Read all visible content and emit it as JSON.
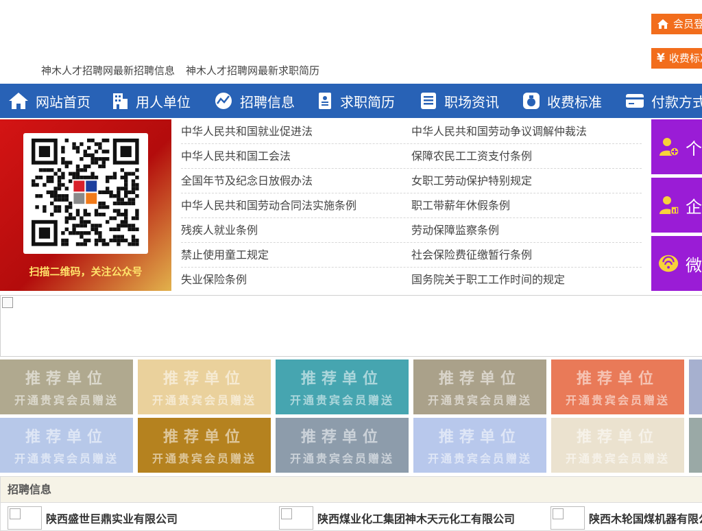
{
  "header": {
    "member_login": "会员登录",
    "pricing": "收费标准",
    "links": [
      "神木人才招聘网最新招聘信息",
      "神木人才招聘网最新求职简历"
    ]
  },
  "nav": [
    {
      "label": "网站首页",
      "icon": "home-icon"
    },
    {
      "label": "用人单位",
      "icon": "building-icon"
    },
    {
      "label": "招聘信息",
      "icon": "chart-icon"
    },
    {
      "label": "求职简历",
      "icon": "resume-icon"
    },
    {
      "label": "职场资讯",
      "icon": "news-icon"
    },
    {
      "label": "收费标准",
      "icon": "money-bag-icon"
    },
    {
      "label": "付款方式",
      "icon": "card-icon"
    }
  ],
  "qr": {
    "caption": "扫描二维码，关注公众号"
  },
  "laws": [
    [
      "中华人民共和国就业促进法",
      "中华人民共和国劳动争议调解仲裁法"
    ],
    [
      "中华人民共和国工会法",
      "保障农民工工资支付条例"
    ],
    [
      "全国年节及纪念日放假办法",
      "女职工劳动保护特别规定"
    ],
    [
      "中华人民共和国劳动合同法实施条例",
      "职工带薪年休假条例"
    ],
    [
      "残疾人就业条例",
      "劳动保障监察条例"
    ],
    [
      "禁止使用童工规定",
      "社会保险费征缴暂行条例"
    ],
    [
      "失业保险条例",
      "国务院关于职工工作时间的规定"
    ]
  ],
  "side_buttons": [
    {
      "label": "个",
      "icon": "person-add-icon"
    },
    {
      "label": "企",
      "icon": "enterprise-icon"
    },
    {
      "label": "微",
      "icon": "wechat-icon"
    }
  ],
  "tiles": {
    "title": "推荐单位",
    "subtitle": "开通贵宾会员赠送",
    "colors": [
      "#b0a98f",
      "#ead19c",
      "#46a5b0",
      "#aaa18a",
      "#e97a58",
      "#a6b0cf",
      "#b7c8e9",
      "#b5821f",
      "#8d9cab",
      "#b8c8ec",
      "#ebe2cf",
      "#9aa9a6"
    ]
  },
  "jobs": {
    "heading": "招聘信息",
    "items": [
      "陕西盛世巨鼎实业有限公司",
      "陕西煤业化工集团神木天元化工有限公司",
      "陕西木轮国煤机器有限公司"
    ]
  }
}
